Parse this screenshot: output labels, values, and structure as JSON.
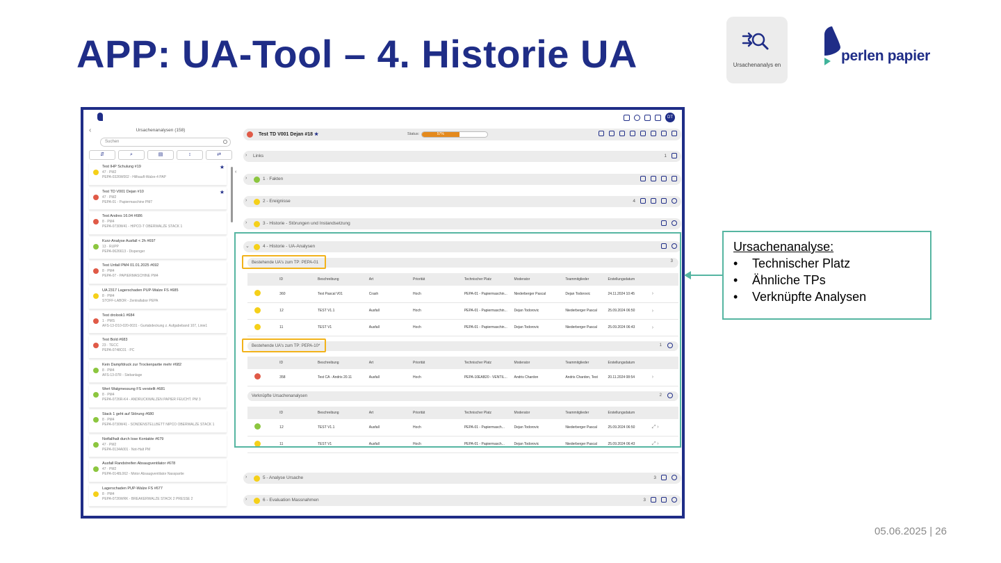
{
  "slide": {
    "title": "APP: UA-Tool – 4. Historie UA",
    "app_tile_label": "Ursachenanalys en",
    "logo_text": "perlen papier",
    "footer": "05.06.2025 | 26"
  },
  "colors": {
    "brand": "#1f2d87",
    "accent_teal": "#55b5a1",
    "highlight": "#f2b21a",
    "red": "#e05a47",
    "yellow": "#f5d019",
    "green": "#8cc63f",
    "progress": "#e48a1d"
  },
  "sidebar": {
    "title": "Ursachenanalysen (158)",
    "search_placeholder": "Suchen",
    "tools": [
      "⇵",
      "⌕",
      "▤",
      "↕",
      "⇄"
    ],
    "items": [
      {
        "title": "Test IHP Schulung #19",
        "line2": "47 · PM2",
        "line3": "PEPA-0326W002 - Hilfsaufl-Walze-4 PAP",
        "color": "#f5d019",
        "starred": true
      },
      {
        "title": "Test TD V001 Dejan #10",
        "line2": "47 · PM2",
        "line3": "PEPA-01 - Papiermaschine PM7",
        "color": "#e05a47",
        "starred": true
      },
      {
        "title": "Test Andres 16.04 #686",
        "line2": "8 · PM4",
        "line3": "PEPA-0730W41 - HIPCO-T OBERWALZE STACK 1",
        "color": "#e05a47",
        "starred": false
      },
      {
        "title": "Kurz-Analyse Ausfall < 2h #697",
        "line2": "13 · RUPP",
        "line3": "PEPA-0626613 - Dispenger",
        "color": "#8cc63f",
        "starred": false
      },
      {
        "title": "Test Unfall PM4 01.01.2025 #692",
        "line2": "8 · PM4",
        "line3": "PEPA-07 - PAPIERMASCHINE PM4",
        "color": "#e05a47",
        "starred": false
      },
      {
        "title": "UA 2317 Lagerschaden PUP-Walze FS #685",
        "line2": "8 · PM4",
        "line3": "STOFF-LABOR - Zentrallabor PEPA",
        "color": "#f5d019",
        "starred": false
      },
      {
        "title": "Test drolook1 #684",
        "line2": "1 · PMS",
        "line3": "AFS-13-D10-020-0031 - Gurtabdeckung z. Aufgabeband 107, Linie1",
        "color": "#e05a47",
        "starred": false
      },
      {
        "title": "Test Bold #683",
        "line2": "23 · TECC",
        "line3": "PEPA-0748C01 · PC",
        "color": "#e05a47",
        "starred": false
      },
      {
        "title": "Kein Dampfdruck zur Trockenpartie mehr #682",
        "line2": "8 · PM4",
        "line3": "AFS-13-07R - Siebanlage",
        "color": "#8cc63f",
        "starred": false
      },
      {
        "title": "Wert Walgmessung FS verstellt #681",
        "line2": "8 · PM4",
        "line3": "PEPA-0726R-K4 - ANDRUCKWALZEN PAPIER FEUCHT. PM 3",
        "color": "#8cc63f",
        "starred": false
      },
      {
        "title": "Stack 1 geht auf Störung #680",
        "line2": "8 · PM4",
        "line3": "PEPA-0730W41 - SONDENSTELLBETT NIPCO OBERWALZE STACK 1",
        "color": "#8cc63f",
        "starred": false
      },
      {
        "title": "Notfallhalt durch lose Kontakte #679",
        "line2": "47 · PM2",
        "line3": "PEPA-0134A001 · Not-Halt PM",
        "color": "#8cc63f",
        "starred": false
      },
      {
        "title": "Ausfall Randstreifen Absaugventilator #678",
        "line2": "47 · PM2",
        "line3": "PEPA-0148L062 - Motor Absaugventilator Nasspartie",
        "color": "#8cc63f",
        "starred": false
      },
      {
        "title": "Lagerschaden PUP-Walze FS #677",
        "line2": "8 · PM4",
        "line3": "PEPA-0726WRK - BREAKERWALZE STACK 2 PRESSE 2",
        "color": "#f5d019",
        "starred": false
      }
    ]
  },
  "main": {
    "header": {
      "title": "Test TD V001 Dejan #18",
      "status_label": "Status:",
      "progress_pct": 57,
      "progress_text": "57%"
    },
    "sections": [
      {
        "label": "Links",
        "count": "1",
        "color": "none"
      },
      {
        "label": "1 · Fakten",
        "count": "",
        "color": "#8cc63f"
      },
      {
        "label": "2 - Ereignisse",
        "count": "4",
        "color": "#f5d019"
      },
      {
        "label": "3 - Historie - Störungen und Instandsetzung",
        "count": "",
        "color": "#f5d019"
      },
      {
        "label": "4 - Historie - UA-Analysen",
        "count": "",
        "color": "#f5d019"
      },
      {
        "label": "5 - Analyse Ursache",
        "count": "3",
        "color": "#f5d019"
      },
      {
        "label": "6 - Evaluation Massnahmen",
        "count": "3",
        "color": "#f5d019"
      }
    ],
    "tables": [
      {
        "title": "Bestehende UA's zum TP: PEPA-01",
        "count": "3",
        "headers": [
          "ID",
          "Beschreibung",
          "Art",
          "Priorität",
          "Technischer Platz",
          "Moderator",
          "Teammitglieder",
          "Erstellungsdatum"
        ],
        "rows": [
          {
            "color": "#f5d019",
            "cells": [
              "360",
              "Test Pascal V01",
              "Crash",
              "Hoch",
              "PEPA-01 - Papiermaschin...",
              "Niederberger Pascal",
              "Dejan Todorovic",
              "24.11.2024 10:45"
            ]
          },
          {
            "color": "#f5d019",
            "cells": [
              "12",
              "TEST V1.1",
              "Ausfall",
              "Hoch",
              "PEPA-01 - Papiermaschin...",
              "Dejan Todorovic",
              "Niederberger Pascal",
              "25.09.2024 06:50"
            ]
          },
          {
            "color": "#f5d019",
            "cells": [
              "11",
              "TEST V1",
              "Ausfall",
              "Hoch",
              "PEPA-01 - Papiermaschin...",
              "Dejan Todorovic",
              "Niederberger Pascal",
              "25.09.2024 06:43"
            ]
          }
        ]
      },
      {
        "title": "Bestehende UA's zum TP: PEPA-10*",
        "count": "1",
        "headers": [
          "ID",
          "Beschreibung",
          "Art",
          "Priorität",
          "Technischer Platz",
          "Moderator",
          "Teammitglieder",
          "Erstellungsdatum"
        ],
        "rows": [
          {
            "color": "#e05a47",
            "cells": [
              "358",
              "Test CA - Andris 20.11",
              "Ausfall",
              "Hoch",
              "PEPA-10EAB20 - VENTIL...",
              "Andris Chardon",
              "Andris Chardon, Test",
              "20.11.2024 08:54"
            ]
          }
        ]
      },
      {
        "title": "Verknüpfte Ursachenanalysen",
        "count": "2",
        "headers": [
          "ID",
          "Beschreibung",
          "Art",
          "Priorität",
          "Technischer Platz",
          "Moderator",
          "Teammitglieder",
          "Erstellungsdatum"
        ],
        "rows": [
          {
            "color": "#8cc63f",
            "cells": [
              "12",
              "TEST V1.1",
              "Ausfall",
              "Hoch",
              "PEPA-01 - Papiermasch...",
              "Dejan Todorovic",
              "Niederberger Pascal",
              "25.09.2024 06:50"
            ]
          },
          {
            "color": "#f5d019",
            "cells": [
              "11",
              "TEST V1",
              "Ausfall",
              "Hoch",
              "PEPA-01 - Papiermasch...",
              "Dejan Todorovic",
              "Niederberger Pascal",
              "25.09.2024 06:43"
            ]
          }
        ]
      }
    ]
  },
  "callout": {
    "title": "Ursachenanalyse:",
    "items": [
      "Technischer Platz",
      "Ähnliche TPs",
      "Verknüpfte Analysen"
    ]
  }
}
